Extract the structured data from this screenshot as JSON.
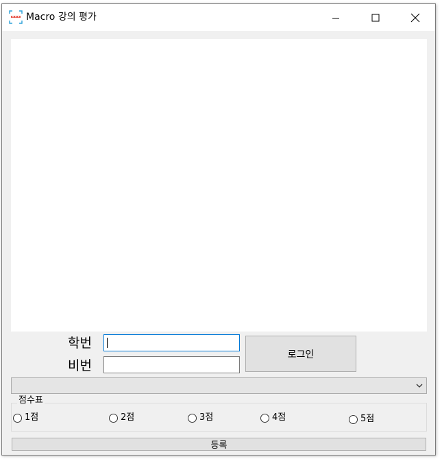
{
  "window": {
    "title": "Macro 강의 평가",
    "controls": {
      "minimize": "minimize",
      "maximize": "maximize",
      "close": "close"
    }
  },
  "login": {
    "student_id_label": "학번",
    "password_label": "비번",
    "student_id_value": "",
    "password_value": "",
    "login_button": "로그인"
  },
  "course_select": {
    "selected": ""
  },
  "score_group": {
    "legend": "점수표",
    "options": [
      "1점",
      "2점",
      "3점",
      "4점",
      "5점"
    ]
  },
  "submit_button": "등록",
  "icons": {
    "app": "app-icon",
    "combo_arrow": "chevron-down-icon"
  },
  "colors": {
    "window_bg": "#f0f0f0",
    "focus_border": "#0078d7",
    "button_bg": "#e1e1e1"
  }
}
